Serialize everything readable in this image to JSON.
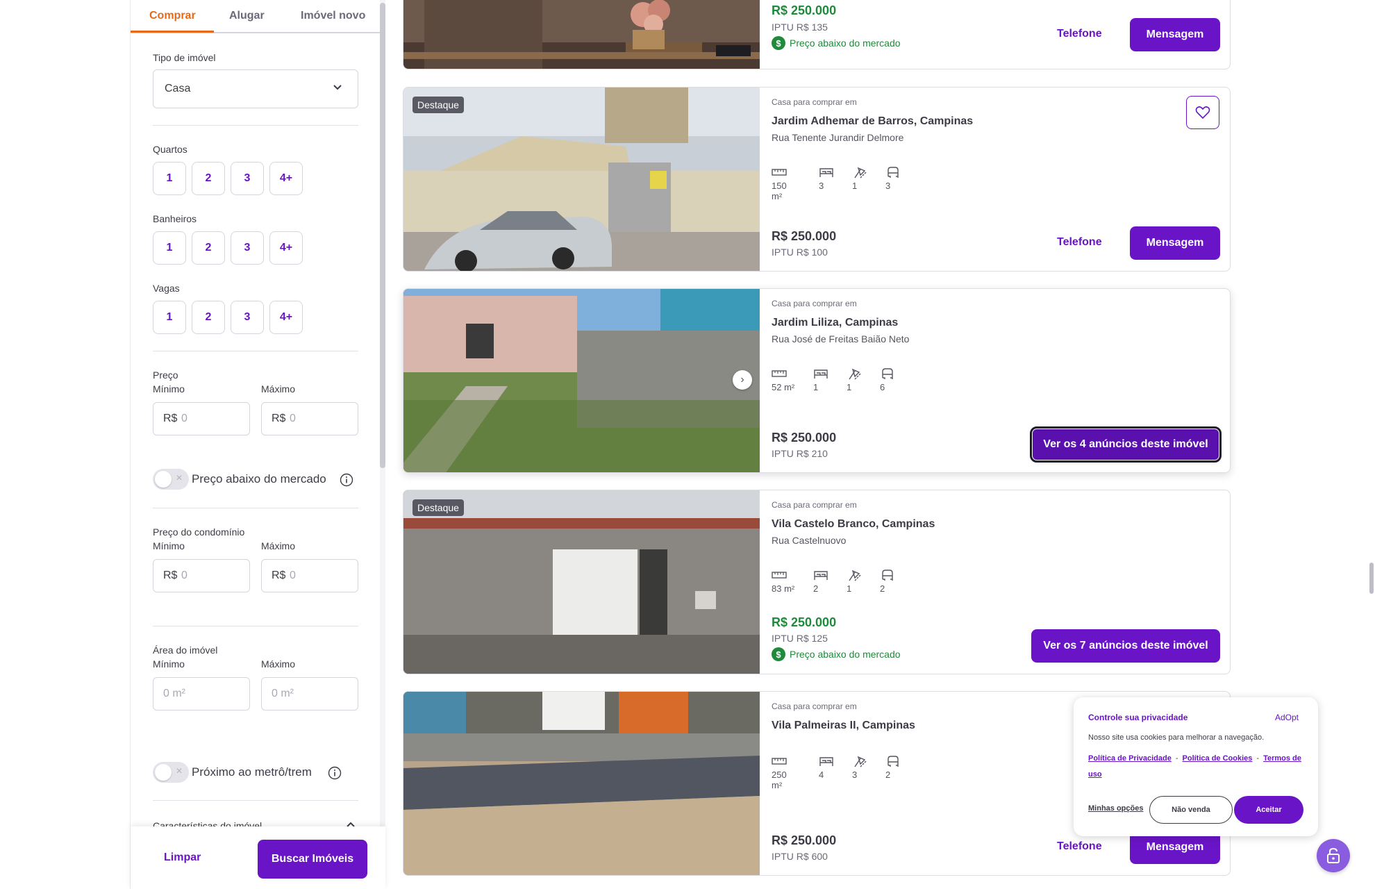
{
  "sidebar": {
    "tabs": [
      "Comprar",
      "Alugar",
      "Imóvel novo"
    ],
    "property_type": {
      "label": "Tipo de imóvel",
      "value": "Casa"
    },
    "bedrooms": {
      "label": "Quartos",
      "options": [
        "1",
        "2",
        "3",
        "4+"
      ]
    },
    "bathrooms": {
      "label": "Banheiros",
      "options": [
        "1",
        "2",
        "3",
        "4+"
      ]
    },
    "parking": {
      "label": "Vagas",
      "options": [
        "1",
        "2",
        "3",
        "4+"
      ]
    },
    "price": {
      "label": "Preço",
      "min_label": "Mínimo",
      "max_label": "Máximo",
      "prefix": "R$",
      "min_placeholder": "0",
      "max_placeholder": "0"
    },
    "below_market_toggle": {
      "label": "Preço abaixo do mercado",
      "on": false
    },
    "condo_price": {
      "label": "Preço do condomínio",
      "min_label": "Mínimo",
      "max_label": "Máximo",
      "prefix": "R$",
      "min_placeholder": "0",
      "max_placeholder": "0"
    },
    "area": {
      "label": "Área do imóvel",
      "min_label": "Mínimo",
      "max_label": "Máximo",
      "min_placeholder": "0 m²",
      "max_placeholder": "0 m²"
    },
    "metro_toggle": {
      "label": "Próximo ao metrô/trem",
      "on": false
    },
    "features_section": "Características do imóvel",
    "clear_label": "Limpar",
    "search_label": "Buscar Imóveis"
  },
  "listings": [
    {
      "price": "R$ 250.000",
      "iptu": "IPTU R$ 135",
      "below_market": "Preço abaixo do mercado",
      "phone_label": "Telefone",
      "message_label": "Mensagem"
    },
    {
      "badge": "Destaque",
      "type_label": "Casa para comprar em",
      "location": "Jardim Adhemar de Barros, Campinas",
      "street": "Rua Tenente Jurandir Delmore",
      "area": "150 m²",
      "bedrooms": "3",
      "bathrooms": "1",
      "parking": "3",
      "price": "R$ 250.000",
      "iptu": "IPTU R$ 100",
      "phone_label": "Telefone",
      "message_label": "Mensagem"
    },
    {
      "type_label": "Casa para comprar em",
      "location": "Jardim Liliza, Campinas",
      "street": "Rua José de Freitas Baião Neto",
      "area": "52 m²",
      "bedrooms": "1",
      "bathrooms": "1",
      "parking": "6",
      "price": "R$ 250.000",
      "iptu": "IPTU R$ 210",
      "cta_label": "Ver os 4 anúncios deste imóvel"
    },
    {
      "badge": "Destaque",
      "type_label": "Casa para comprar em",
      "location": "Vila Castelo Branco, Campinas",
      "street": "Rua Castelnuovo",
      "area": "83 m²",
      "bedrooms": "2",
      "bathrooms": "1",
      "parking": "2",
      "price": "R$ 250.000",
      "iptu": "IPTU R$ 125",
      "below_market": "Preço abaixo do mercado",
      "cta_label": "Ver os 7 anúncios deste imóvel"
    },
    {
      "type_label": "Casa para comprar em",
      "location": "Vila Palmeiras II, Campinas",
      "area": "250 m²",
      "bedrooms": "4",
      "bathrooms": "3",
      "parking": "2",
      "price": "R$ 250.000",
      "iptu": "IPTU R$ 600",
      "phone_label": "Telefone",
      "message_label": "Mensagem"
    }
  ],
  "cookie_banner": {
    "title": "Controle sua privacidade",
    "brand": "AdOpt",
    "description": "Nosso site usa cookies para melhorar a navegação.",
    "privacy_policy": "Política de Privacidade",
    "cookie_policy": "Política de Cookies",
    "terms": "Termos de uso",
    "my_options": "Minhas opções",
    "decline": "Não venda",
    "accept": "Aceitar"
  },
  "colors": {
    "accent": "#6a14c8",
    "tab_active": "#e66a1a",
    "green": "#1e8a3a"
  }
}
